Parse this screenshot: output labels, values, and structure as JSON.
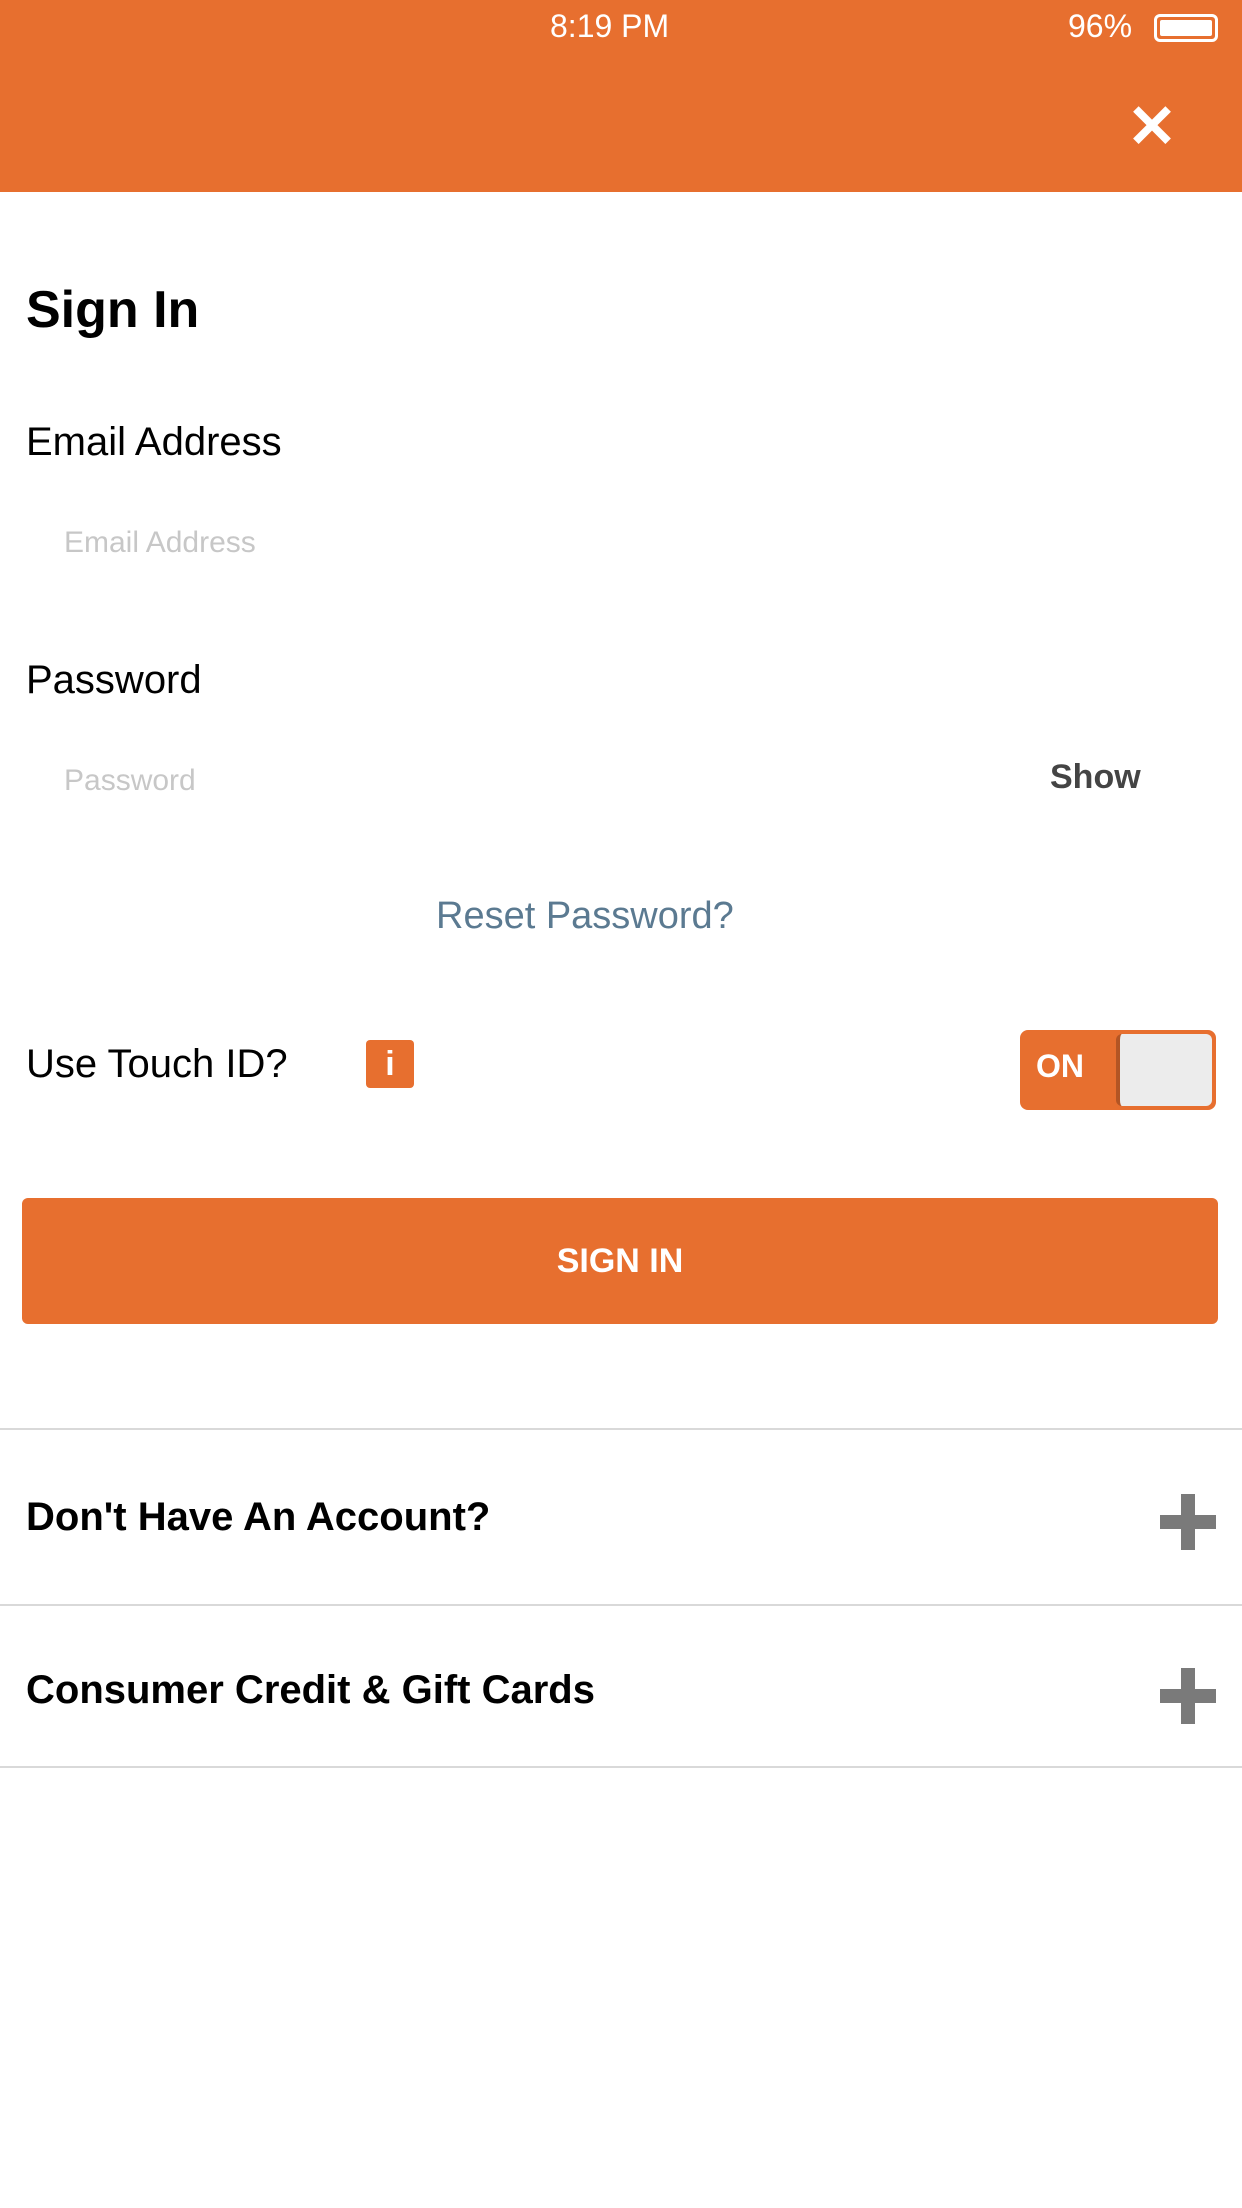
{
  "status_bar": {
    "time": "8:19 PM",
    "battery": "96%"
  },
  "header": {
    "close_icon": "close-icon"
  },
  "form": {
    "title": "Sign In",
    "email_label": "Email Address",
    "email_placeholder": "Email Address",
    "password_label": "Password",
    "password_placeholder": "Password",
    "show_label": "Show",
    "reset_link": "Reset Password?",
    "touch_id_label": "Use Touch ID?",
    "info_icon": "i",
    "switch_label": "ON",
    "signin_button": "SIGN IN"
  },
  "list": {
    "items": [
      {
        "label": "Don't Have An Account?",
        "icon": "plus-icon"
      },
      {
        "label": "Consumer Credit & Gift Cards",
        "icon": "plus-icon"
      }
    ]
  },
  "colors": {
    "accent": "#e76f2f",
    "link": "#5b7a91"
  }
}
